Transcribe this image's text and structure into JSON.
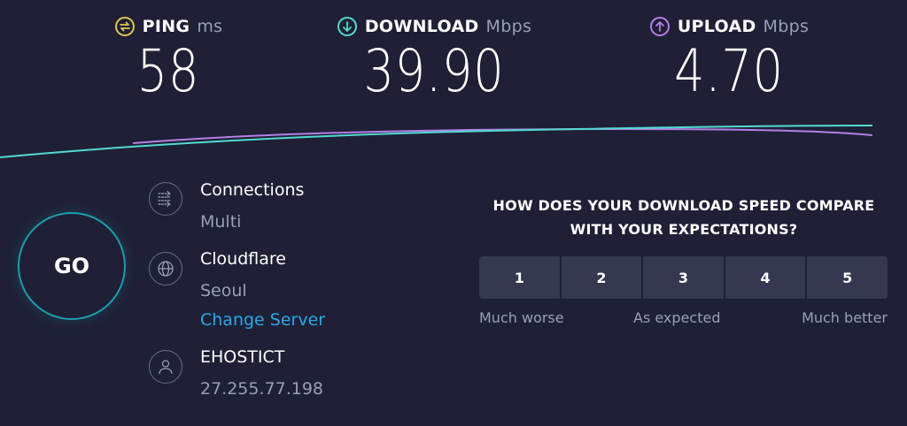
{
  "metrics": {
    "ping": {
      "label": "PING",
      "unit": "ms",
      "value": "58",
      "color": "#e3c64f",
      "icon": "ping-icon"
    },
    "download": {
      "label": "DOWNLOAD",
      "unit": "Mbps",
      "value": "39.90",
      "color": "#50dcd0",
      "icon": "download-arrow-icon"
    },
    "upload": {
      "label": "UPLOAD",
      "unit": "Mbps",
      "value": "4.70",
      "color": "#b57fe6",
      "icon": "upload-arrow-icon"
    }
  },
  "go_button": {
    "label": "GO"
  },
  "connections": {
    "title": "Connections",
    "value": "Multi",
    "icon": "connections-icon"
  },
  "server": {
    "title": "Cloudflare",
    "location": "Seoul",
    "change_link": "Change Server",
    "icon": "globe-icon"
  },
  "provider": {
    "title": "EHOSTICT",
    "ip": "27.255.77.198",
    "icon": "user-icon"
  },
  "survey": {
    "question_line1": "HOW DOES YOUR DOWNLOAD SPEED COMPARE",
    "question_line2": "WITH YOUR EXPECTATIONS?",
    "options": [
      "1",
      "2",
      "3",
      "4",
      "5"
    ],
    "scale": {
      "low": "Much worse",
      "mid": "As expected",
      "high": "Much better"
    }
  },
  "colors": {
    "background": "#1f2036",
    "accent_teal": "#1c9dad",
    "link_blue": "#29a9e6",
    "download_line": "#50dcd0",
    "upload_line": "#b57fe6"
  }
}
